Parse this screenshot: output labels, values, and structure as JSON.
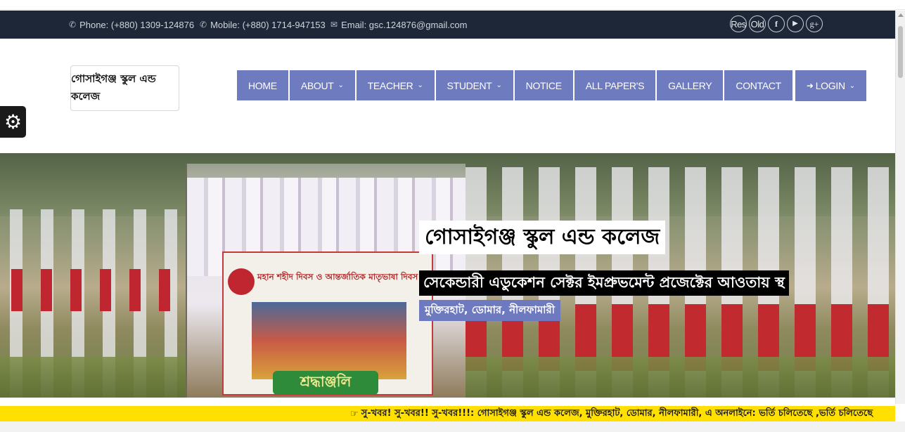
{
  "topbar": {
    "phone": "Phone: (+880) 1309-124876",
    "mobile": "Mobile: (+880) 1714-947153",
    "email": "Email: gsc.124876@gmail.com",
    "social": [
      "Res",
      "Old",
      "facebook-icon",
      "youtube-icon",
      "google-plus-icon"
    ]
  },
  "logo": {
    "text": "গোসাইগঞ্জ স্কুল এন্ড কলেজ"
  },
  "nav": {
    "items": [
      {
        "label": "HOME",
        "dropdown": false
      },
      {
        "label": "ABOUT",
        "dropdown": true
      },
      {
        "label": "TEACHER",
        "dropdown": true
      },
      {
        "label": "STUDENT",
        "dropdown": true
      },
      {
        "label": "NOTICE",
        "dropdown": false
      },
      {
        "label": "ALL PAPER'S",
        "dropdown": false
      },
      {
        "label": "GALLERY",
        "dropdown": false
      },
      {
        "label": "CONTACT",
        "dropdown": false
      }
    ],
    "login": "LOGIN"
  },
  "banner": {
    "title": "গোসাইগঞ্জ স্কুল এন্ড কলেজ",
    "subtitle": "সেকেন্ডারী এডুকেশন সেক্টর ইমপ্রুভমেন্ট প্রজেক্টের আওতায় স্থ",
    "location": "মুক্তিরহাট, ডোমার, নীলফামারী",
    "photo_banner_line": "মহান শহীদ দিবস ও আন্তর্জাতিক মাতৃভাষা দিবস",
    "photo_banner_tribute": "শ্রদ্ধাঞ্জলি"
  },
  "ticker": {
    "text": "সু-খবর! সু-খবর!! সু-খবর!!!: গোসাইগঞ্জ স্কুল এন্ড কলেজ, মুক্তিরহাট, ডোমার, নীলফামারী, এ অনলাইনে: ভর্তি চলিতেছে ,ভর্তি চলিতেছে"
  },
  "colors": {
    "topbar": "#1d2737",
    "nav": "#6f7bbf",
    "ticker": "#ffe000",
    "location_bg": "#6e7ac0"
  }
}
